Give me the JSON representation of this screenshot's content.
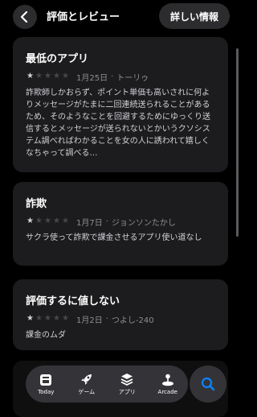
{
  "header": {
    "title": "評価とレビュー",
    "detail_button": "詳しい情報"
  },
  "reviews": [
    {
      "title": "最低のアプリ",
      "rating": 1,
      "date": "1月25日",
      "separator": "·",
      "author": "トーリゥ",
      "body": "詐欺師しかおらず、ポイント単価も高いされに何よりメッセージがたまに二回連続送られることがあるため、そのようなことを回避するためにゆっくり送信するとメッセージが送られないとかいうクソシステム調べればわかることを女の人に誘われて嬉しくなちゃって調べる…"
    },
    {
      "title": "詐欺",
      "rating": 1,
      "date": "1月7日",
      "separator": "·",
      "author": "ジョンソンたかし",
      "body": "サクラ使って詐欺で課金させるアプリ使い道なし"
    },
    {
      "title": "評価するに値しない",
      "rating": 1,
      "date": "1月2日",
      "separator": "·",
      "author": "つよし-240",
      "body": "課金のムダ"
    }
  ],
  "tabbar": {
    "items": [
      {
        "label": "Today",
        "icon": "today-icon"
      },
      {
        "label": "ゲーム",
        "icon": "rocket-icon"
      },
      {
        "label": "アプリ",
        "icon": "layers-icon"
      },
      {
        "label": "Arcade",
        "icon": "joystick-icon"
      }
    ],
    "search_icon": "search-icon",
    "accent_color": "#0a84ff"
  }
}
